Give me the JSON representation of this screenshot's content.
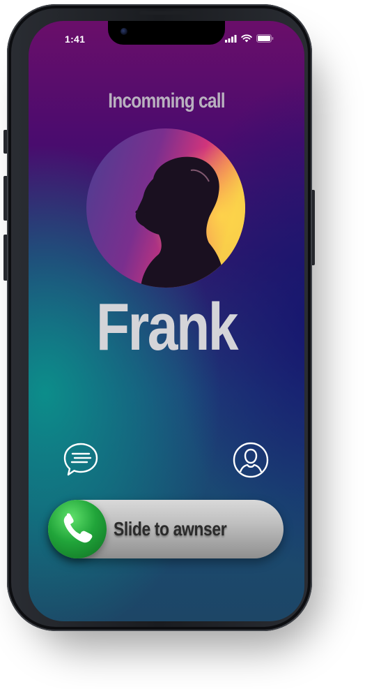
{
  "status_bar": {
    "time": "1:41",
    "icons": [
      "signal-icon",
      "wifi-icon",
      "battery-icon"
    ]
  },
  "call": {
    "title": "Incomming call",
    "caller_name": "Frank"
  },
  "actions": {
    "left_icon": "message-icon",
    "right_icon": "contact-icon"
  },
  "slider": {
    "label": "Slide to awnser",
    "handle_icon": "phone-icon"
  },
  "colors": {
    "answer_green": "#21a53a",
    "text_light": "#d4d4d8",
    "title_text": "#b9b1bf"
  }
}
